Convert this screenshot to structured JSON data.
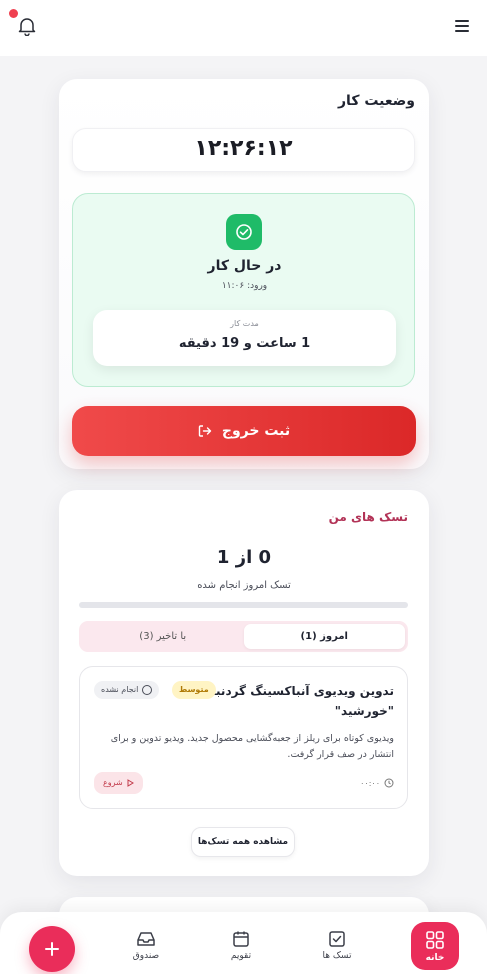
{
  "header": {
    "notification_icon": "bell-icon",
    "menu_icon": "menu-icon"
  },
  "status": {
    "title": "وضعیت کار",
    "clock": "۱۲:۲۶:۱۲",
    "state": "در حال کار",
    "entry": "ورود: ۱۱:۰۶",
    "duration_label": "مدت کار",
    "duration_value": "1 ساعت و 19 دقیقه",
    "checkout_label": "ثبت خروج",
    "state_color": "#1fbb68",
    "checkout_color": "#e03a3a"
  },
  "tasks": {
    "title": "تسک های من",
    "count": "0 از 1",
    "count_label": "تسک امروز انجام شده",
    "progress": 0,
    "tabs": [
      {
        "label": "امروز (1)",
        "active": true
      },
      {
        "label": "با تاخیر (3)",
        "active": false
      }
    ],
    "item": {
      "title": "تدوین ویدیوی آنباکسینگ گردنبند \"خورشید\"",
      "priority": "متوسط",
      "status": "انجام نشده",
      "description": "ویدیوی کوتاه برای ریلز از جعبه‌گشایی محصول جدید. ویدیو تدوین و برای انتشار در صف قرار گرفت.",
      "time": "۰۰:۰۰",
      "start_label": "شروع"
    },
    "view_all_label": "مشاهده همه تسک‌ها"
  },
  "nav": {
    "home": "خانه",
    "tasks": "تسک ها",
    "calendar": "تقویم",
    "inbox": "صندوق",
    "accent": "#ea2d5a"
  }
}
